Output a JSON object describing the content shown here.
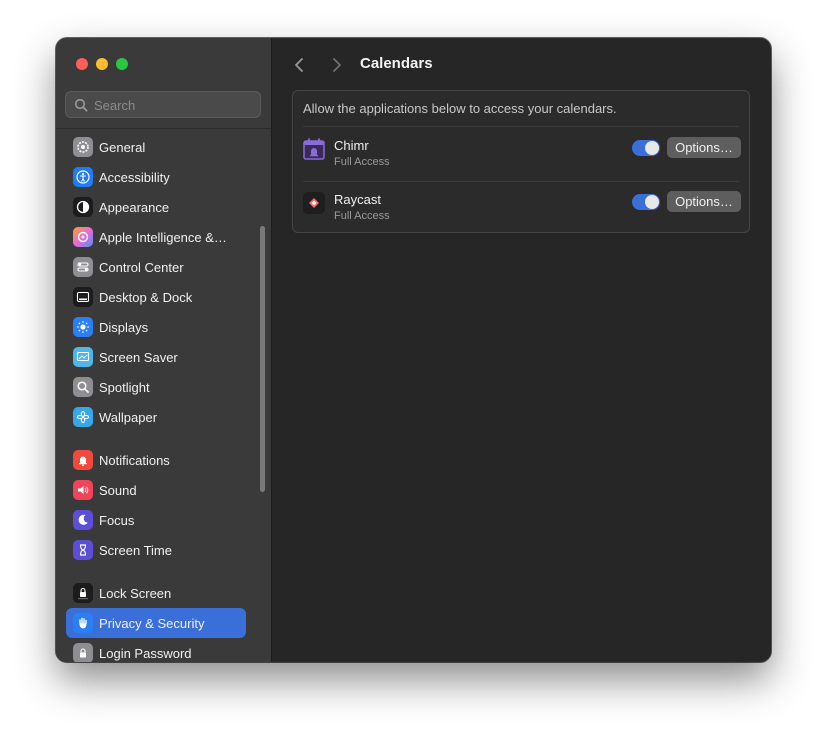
{
  "window": {
    "title": "Calendars"
  },
  "search": {
    "placeholder": "Search"
  },
  "sidebar": {
    "items": [
      {
        "label": "General",
        "icon": "gear-icon",
        "color": "#8e8e93"
      },
      {
        "label": "Accessibility",
        "icon": "accessibility-icon",
        "color": "#1f7cf5"
      },
      {
        "label": "Appearance",
        "icon": "appearance-icon",
        "color": "#1c1c1e"
      },
      {
        "label": "Apple Intelligence &…",
        "icon": "apple-intelligence-icon",
        "color": "#e86ad8"
      },
      {
        "label": "Control Center",
        "icon": "control-center-icon",
        "color": "#8e8e93"
      },
      {
        "label": "Desktop & Dock",
        "icon": "dock-icon",
        "color": "#1c1c1e"
      },
      {
        "label": "Displays",
        "icon": "displays-icon",
        "color": "#2a7ff5"
      },
      {
        "label": "Screen Saver",
        "icon": "screen-saver-icon",
        "color": "#4fb6e8"
      },
      {
        "label": "Spotlight",
        "icon": "spotlight-icon",
        "color": "#8e8e93"
      },
      {
        "label": "Wallpaper",
        "icon": "wallpaper-icon",
        "color": "#36a8e8"
      },
      {
        "label": "Notifications",
        "icon": "notifications-icon",
        "color": "#f0493e"
      },
      {
        "label": "Sound",
        "icon": "sound-icon",
        "color": "#f0445a"
      },
      {
        "label": "Focus",
        "icon": "focus-icon",
        "color": "#5b4fd6"
      },
      {
        "label": "Screen Time",
        "icon": "screen-time-icon",
        "color": "#5b4fd6"
      },
      {
        "label": "Lock Screen",
        "icon": "lock-screen-icon",
        "color": "#1c1c1e"
      },
      {
        "label": "Privacy & Security",
        "icon": "privacy-hand-icon",
        "color": "#2a7ff5",
        "selected": true
      },
      {
        "label": "Login Password",
        "icon": "login-password-icon",
        "color": "#8e8e93"
      }
    ]
  },
  "main": {
    "description": "Allow the applications below to access your calendars.",
    "apps": [
      {
        "name": "Chimr",
        "access": "Full Access",
        "enabled": true,
        "options_label": "Options…",
        "icon": "chimr-icon"
      },
      {
        "name": "Raycast",
        "access": "Full Access",
        "enabled": true,
        "options_label": "Options…",
        "icon": "raycast-icon"
      }
    ]
  },
  "colors": {
    "accent": "#3a6fd9",
    "sidebar_bg": "#3a3a3a",
    "content_bg": "#262626"
  }
}
